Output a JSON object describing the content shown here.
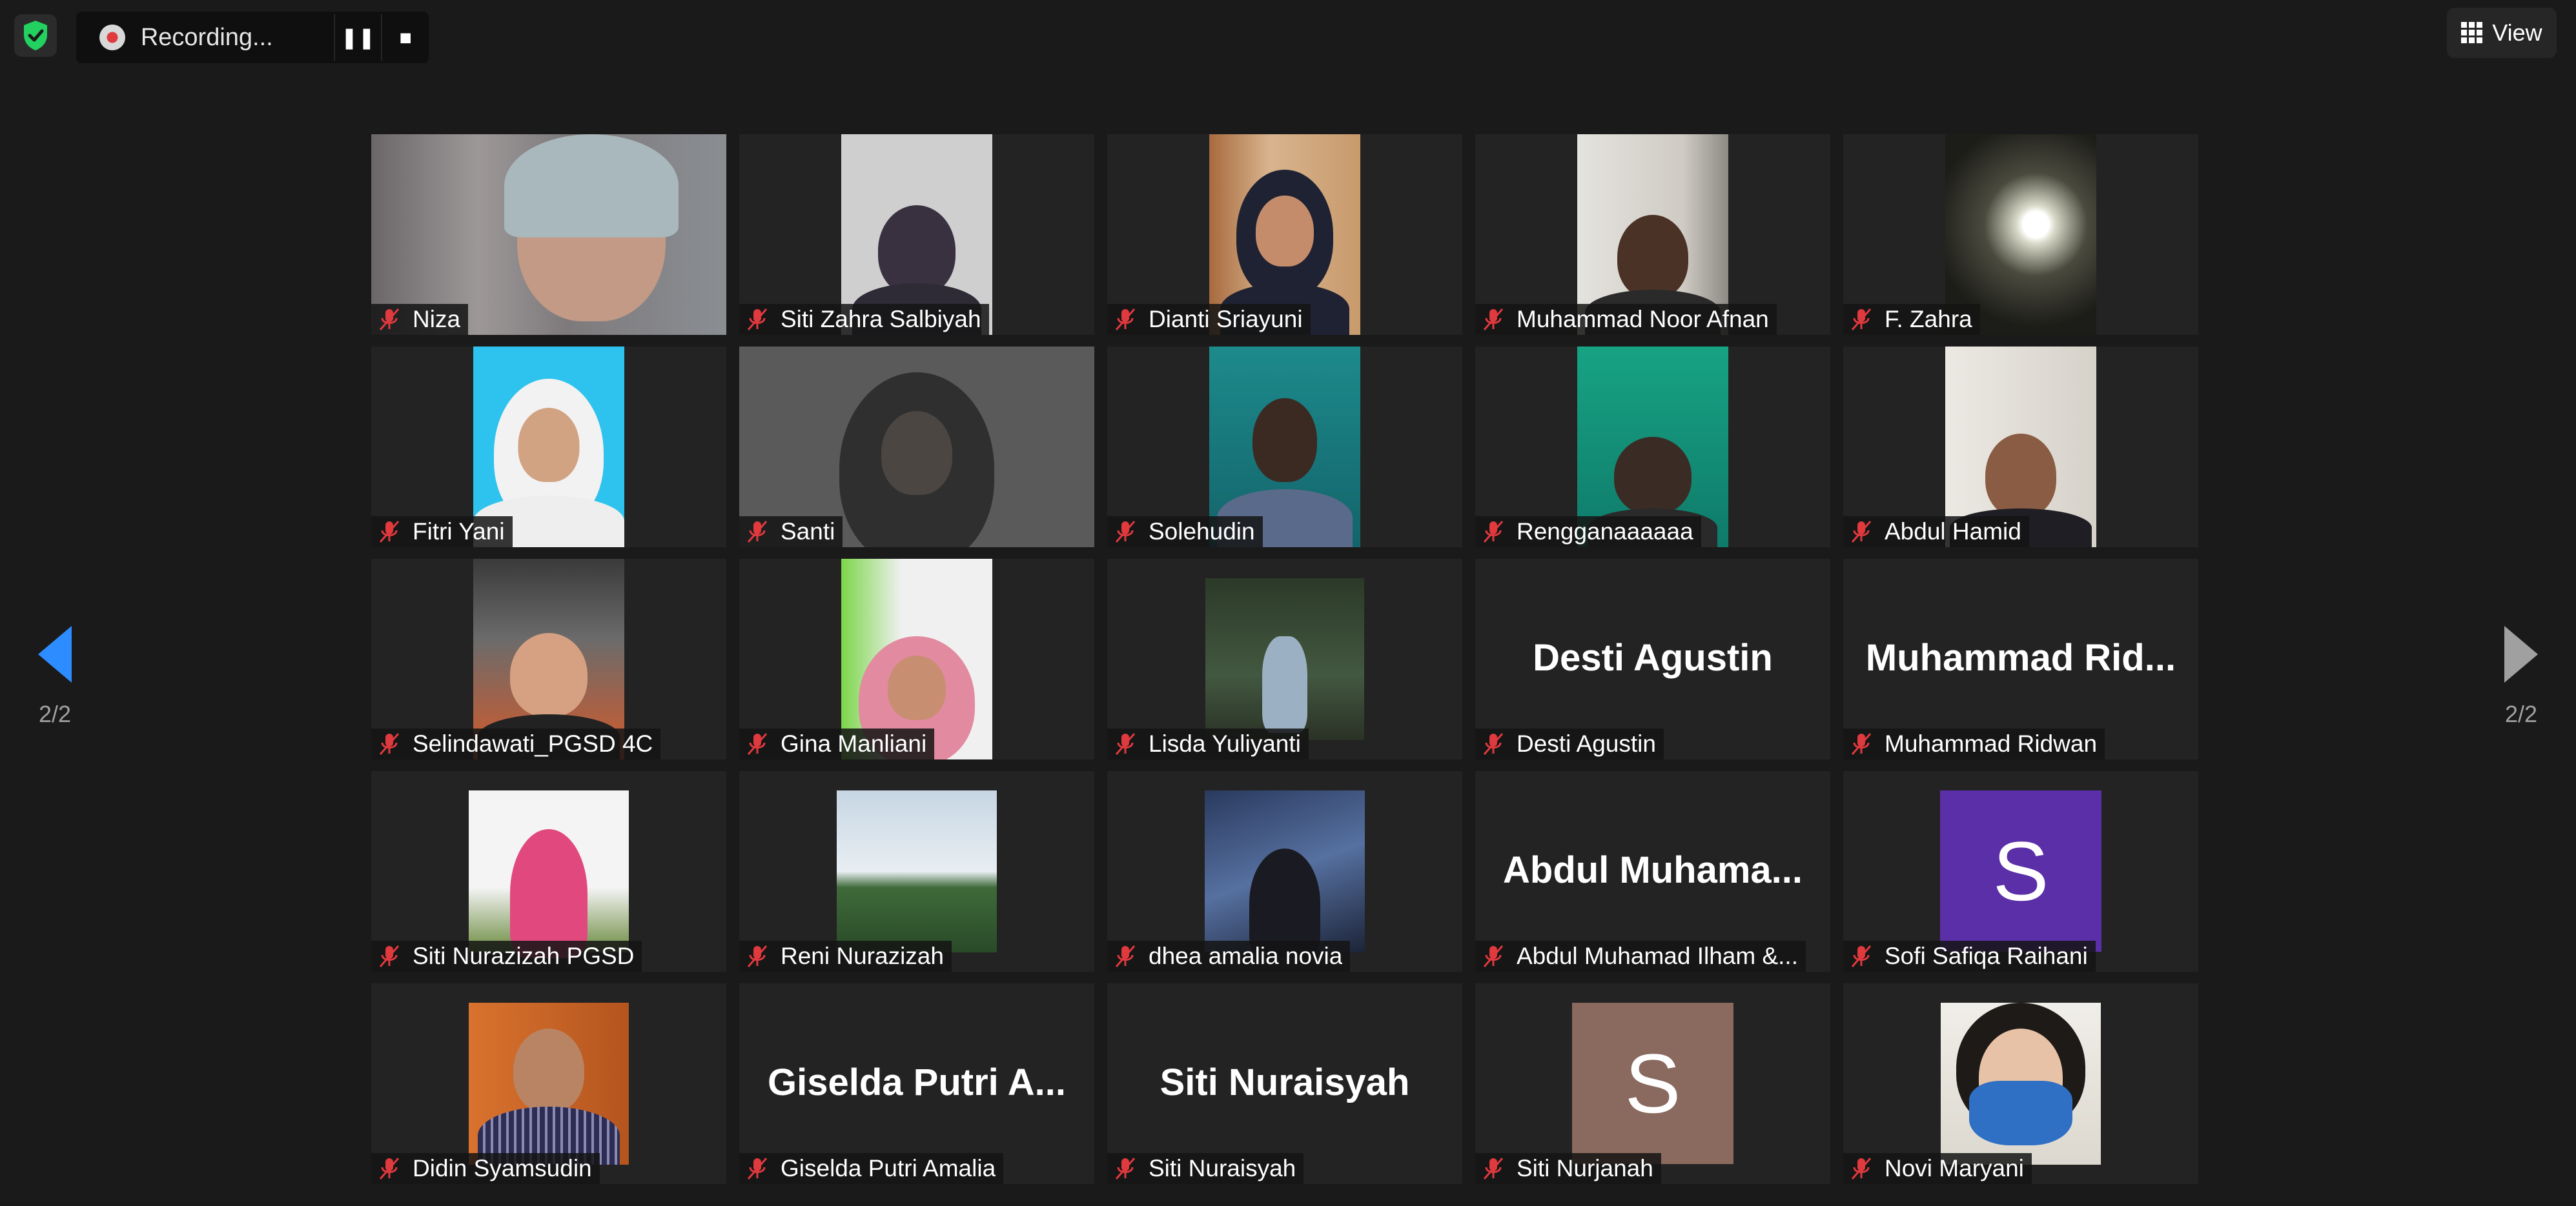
{
  "toolbar": {
    "recording_label": "Recording...",
    "pause_glyph": "❚❚",
    "stop_glyph": "■",
    "view_label": "View"
  },
  "nav": {
    "page_left": "2/2",
    "page_right": "2/2"
  },
  "colors": {
    "accent": "#2d8cff",
    "mute": "#e0393e",
    "shield": "#23d160"
  },
  "participants": [
    {
      "name": "Niza"
    },
    {
      "name": "Siti Zahra Salbiyah"
    },
    {
      "name": "Dianti Sriayuni"
    },
    {
      "name": "Muhammad Noor Afnan"
    },
    {
      "name": "F. Zahra"
    },
    {
      "name": "Fitri Yani"
    },
    {
      "name": "Santi"
    },
    {
      "name": "Solehudin"
    },
    {
      "name": "Rengganaaaaaa"
    },
    {
      "name": "Abdul Hamid"
    },
    {
      "name": "Selindawati_PGSD 4C"
    },
    {
      "name": "Gina Manliani"
    },
    {
      "name": "Lisda Yuliyanti"
    },
    {
      "name": "Desti Agustin",
      "display": "Desti Agustin"
    },
    {
      "name": "Muhammad Ridwan",
      "display": "Muhammad Rid..."
    },
    {
      "name": "Siti Nurazizah PGSD"
    },
    {
      "name": "Reni Nurazizah"
    },
    {
      "name": "dhea amalia novia"
    },
    {
      "name": "Abdul Muhamad Ilham &...",
      "display": "Abdul Muhama..."
    },
    {
      "name": "Sofi Safiqa Raihani",
      "initial": "S"
    },
    {
      "name": "Didin Syamsudin"
    },
    {
      "name": "Giselda Putri Amalia",
      "display": "Giselda Putri A..."
    },
    {
      "name": "Siti Nuraisyah",
      "display": "Siti Nuraisyah"
    },
    {
      "name": "Siti Nurjanah",
      "initial": "S"
    },
    {
      "name": "Novi Maryani"
    }
  ]
}
